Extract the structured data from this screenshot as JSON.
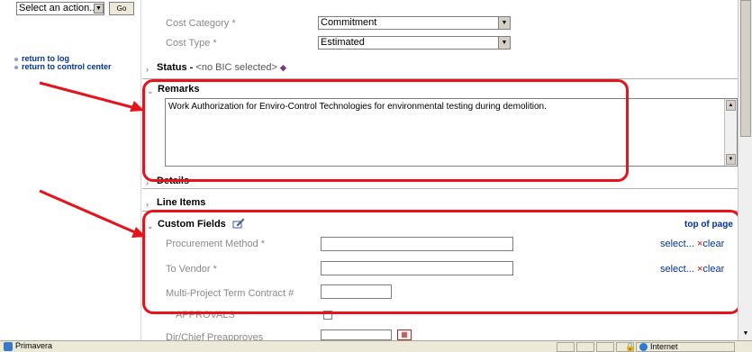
{
  "sidebar": {
    "action_select_value": "Select an action...",
    "go_label": "Go",
    "links": [
      "return to log",
      "return to control center"
    ]
  },
  "form": {
    "cost_category": {
      "label": "Cost Category *",
      "value": "Commitment"
    },
    "cost_type": {
      "label": "Cost Type *",
      "value": "Estimated"
    }
  },
  "sections": {
    "status": {
      "title": "Status -",
      "value": "<no BIC selected>"
    },
    "remarks": {
      "title": "Remarks",
      "text": "Work Authorization for Enviro-Control Technologies for environmental testing during demolition."
    },
    "details": {
      "title": "Details"
    },
    "line_items": {
      "title": "Line Items"
    },
    "custom_fields": {
      "title": "Custom Fields",
      "top_link": "top of page"
    }
  },
  "custom_fields": [
    {
      "label": "Procurement Method *",
      "select_label": "select...",
      "clear_label": "clear"
    },
    {
      "label": "To Vendor *",
      "select_label": "select...",
      "clear_label": "clear"
    },
    {
      "label": "Multi-Project Term Contract #"
    }
  ],
  "partial_rows": {
    "approvals": "** APPROVALS **",
    "preapproves": "Dir/Chief Preapproves"
  },
  "statusbar": {
    "page_title": "Primavera",
    "zone": "Internet"
  },
  "colors": {
    "annotation": "#e8121b",
    "link": "#003399",
    "label_gray": "#8a8a8a"
  }
}
